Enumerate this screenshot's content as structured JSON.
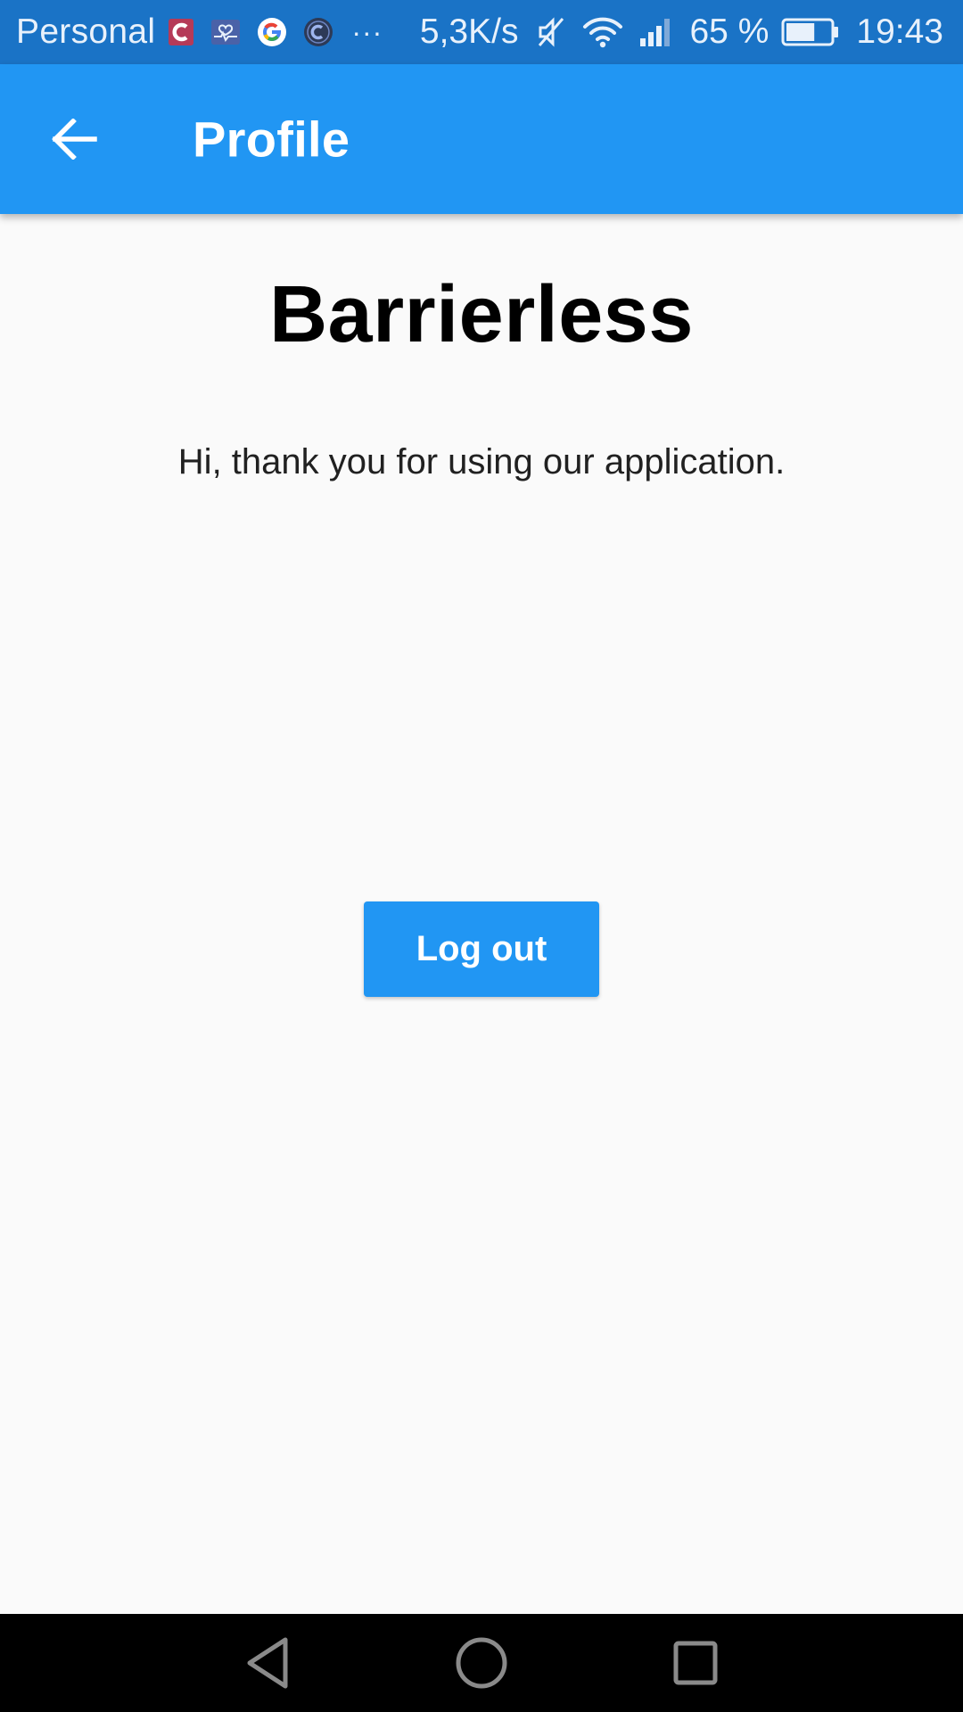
{
  "status_bar": {
    "carrier": "Personal",
    "notification_icons": [
      "c-app-icon",
      "health-app-icon",
      "google-icon",
      "c-circle-app-icon"
    ],
    "more_indicator": "···",
    "net_speed": "5,3K/s",
    "battery_percent": "65 %",
    "battery_level": 0.65,
    "time": "19:43",
    "background_color": "#1a73c6"
  },
  "app_bar": {
    "title": "Profile",
    "back_icon": "arrow-left-icon",
    "background_color": "#2196f3"
  },
  "main": {
    "brand_title": "Barrierless",
    "welcome_text": "Hi, thank you for using our application.",
    "logout_label": "Log out",
    "logout_color": "#2196f3",
    "background_color": "#fafafa"
  },
  "nav_bar": {
    "buttons": [
      "back-triangle-icon",
      "home-circle-icon",
      "recents-square-icon"
    ],
    "background_color": "#000000"
  }
}
